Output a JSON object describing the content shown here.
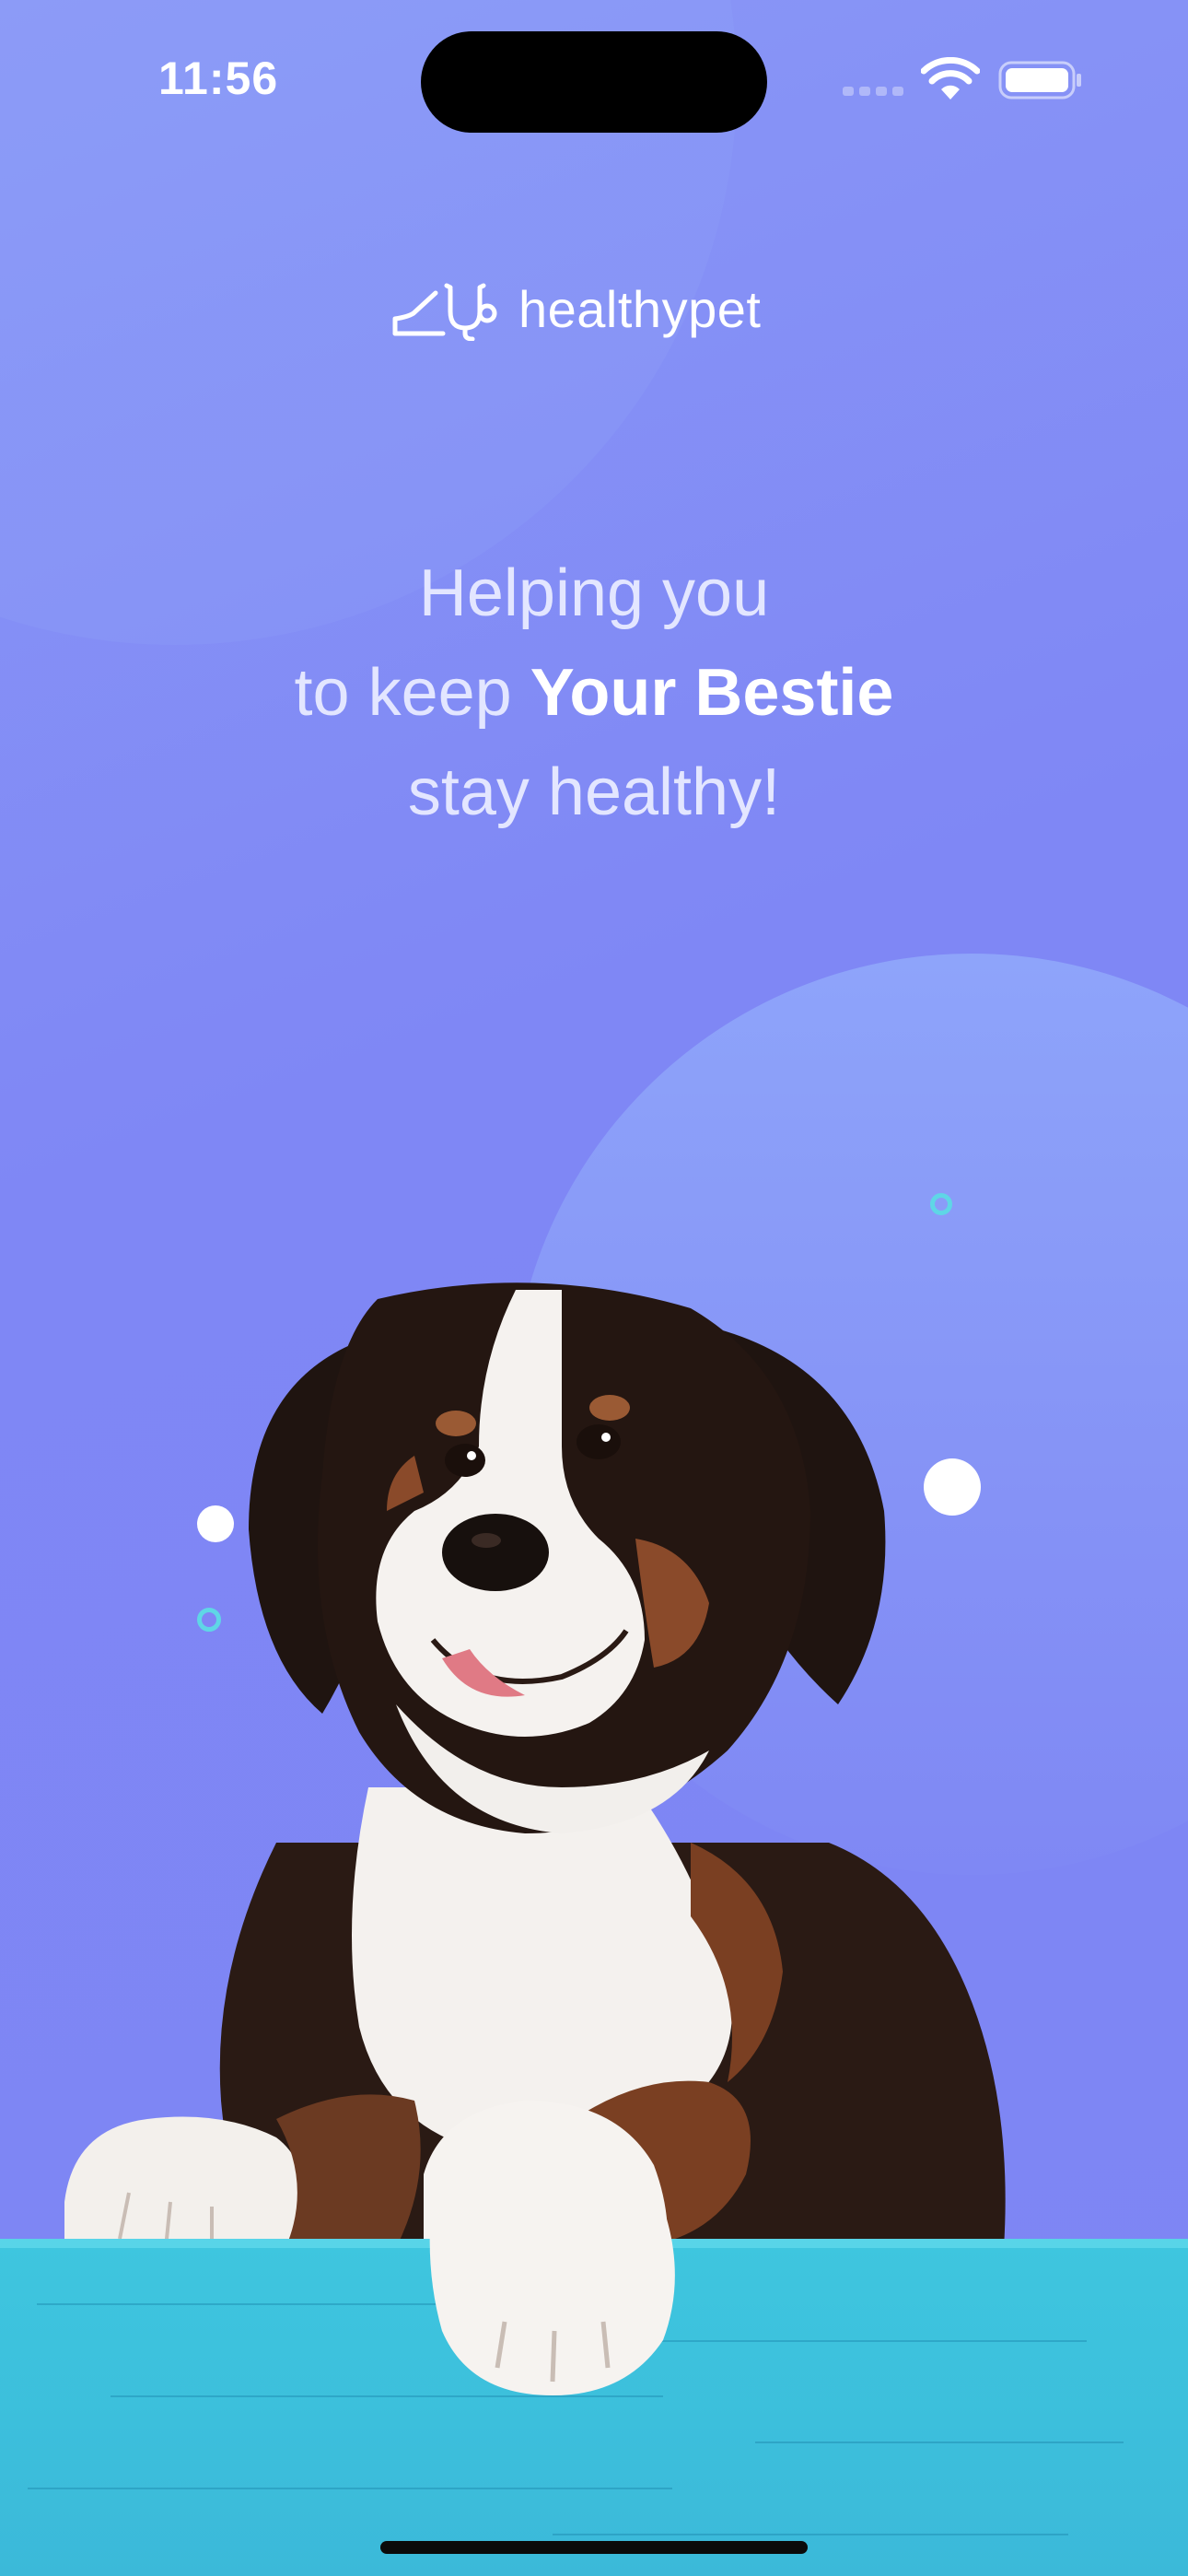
{
  "status_bar": {
    "time": "11:56"
  },
  "brand": {
    "name": "healthypet",
    "icon": "pet-bowl-stethoscope-icon"
  },
  "headline": {
    "line1": "Helping you",
    "line2_prefix": "to keep ",
    "line2_bold": "Your Bestie",
    "line3": "stay healthy!"
  },
  "illustration": {
    "subject": "puppy-image"
  },
  "colors": {
    "background": "#7f87f5",
    "accent": "#5fd6e6",
    "table": "#3ec6df",
    "text": "#ffffff"
  }
}
